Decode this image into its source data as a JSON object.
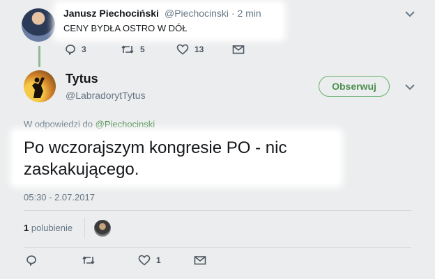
{
  "parent_tweet": {
    "name": "Janusz Piechociński",
    "handle": "@Piechocinski",
    "separator": "·",
    "time": "2 min",
    "text": "CENY BYDŁA OSTRO W DÓŁ",
    "replies": "3",
    "retweets": "5",
    "likes": "13"
  },
  "main_tweet": {
    "name": "Tytus",
    "handle": "@LabradorytTytus",
    "follow_label": "Obserwuj",
    "reply_prefix": "W odpowiedzi do",
    "reply_handle": "@Piechocinski",
    "text": "Po wczorajszym kongresie PO - nic zaskakującego.",
    "timestamp": "05:30 - 2.07.2017",
    "likes_count": "1",
    "likes_label": "polubienie",
    "action_likes": "1"
  },
  "icons": {
    "reply": "reply-icon",
    "retweet": "retweet-icon",
    "like": "heart-icon",
    "message": "envelope-icon",
    "more": "chevron-down-icon"
  },
  "colors": {
    "accent_green": "#4c8f50",
    "thread_line": "#8fbc8f",
    "background": "#ecedee"
  }
}
